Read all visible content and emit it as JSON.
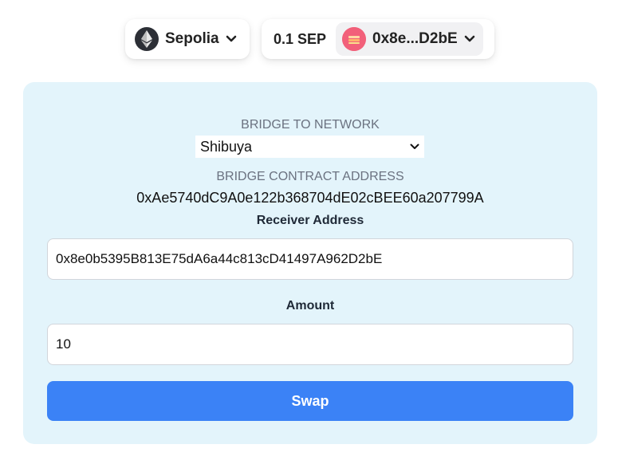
{
  "header": {
    "network": {
      "name": "Sepolia",
      "icon": "ethereum-icon"
    },
    "account": {
      "balance": "0.1 SEP",
      "address_short": "0x8e...D2bE",
      "avatar_color": "#f2607a"
    }
  },
  "bridge": {
    "network_label": "BRIDGE TO NETWORK",
    "network_selected": "Shibuya",
    "contract_label": "BRIDGE CONTRACT ADDRESS",
    "contract_address": "0xAe5740dC9A0e122b368704dE02cBEE60a207799A",
    "receiver_label": "Receiver Address",
    "receiver_value": "0x8e0b5395B813E75dA6a44c813cD41497A962D2bE",
    "amount_label": "Amount",
    "amount_value": "10",
    "swap_label": "Swap"
  },
  "colors": {
    "card_bg": "#e3f4fb",
    "primary": "#3b82f6"
  }
}
